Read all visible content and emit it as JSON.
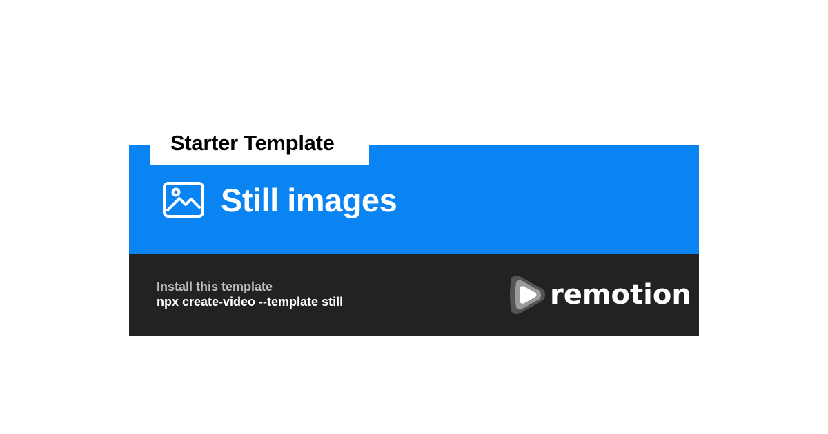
{
  "tag": {
    "label": "Starter Template"
  },
  "header": {
    "icon": "image-icon",
    "title": "Still images"
  },
  "footer": {
    "install_label": "Install this template",
    "install_command": "npx create-video --template still",
    "logo_icon": "remotion-play-icon",
    "logo_text": "remotion"
  },
  "colors": {
    "blue": "#0b84f3",
    "dark": "#222222",
    "white": "#ffffff",
    "muted": "#bdbdbd"
  }
}
